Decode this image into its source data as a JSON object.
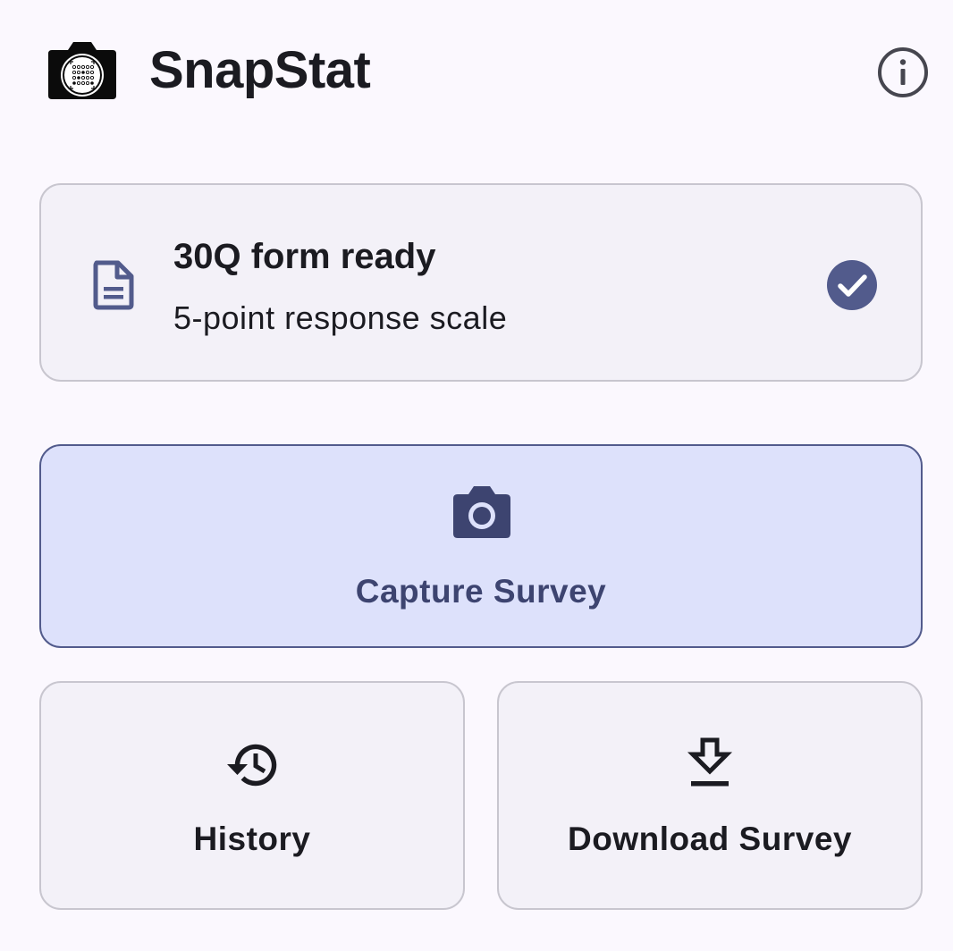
{
  "header": {
    "title": "SnapStat",
    "logo_icon": "camera-logo-icon",
    "info_icon": "info-icon"
  },
  "status_card": {
    "title": "30Q form ready",
    "subtitle": "5-point response scale",
    "doc_icon": "document-icon",
    "status_icon": "check-circle-icon"
  },
  "actions": {
    "capture_label": "Capture Survey",
    "history_label": "History",
    "download_label": "Download Survey"
  },
  "colors": {
    "background": "#fbf8fe",
    "card": "#f3f1f8",
    "primary": "#525b8c",
    "primary_container": "#dde1fb",
    "on_primary_container": "#3d4470",
    "text": "#1b1b21"
  }
}
